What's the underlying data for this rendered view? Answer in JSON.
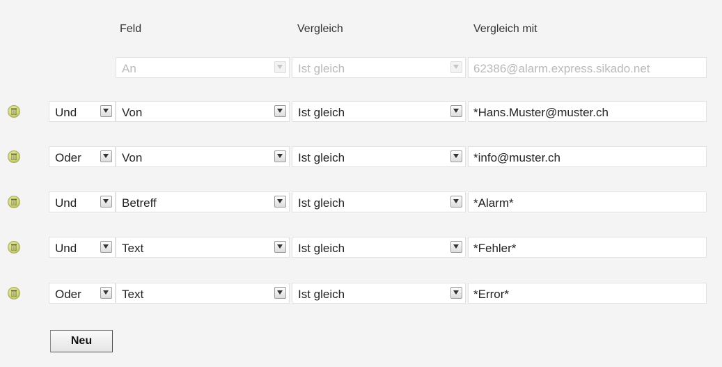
{
  "headers": {
    "feld": "Feld",
    "vergleich": "Vergleich",
    "vergleich_mit": "Vergleich mit"
  },
  "first_row": {
    "feld": "An",
    "vergleich": "Ist gleich",
    "value": "62386@alarm.express.sikado.net"
  },
  "rows": [
    {
      "logic": "Und",
      "feld": "Von",
      "vergleich": "Ist gleich",
      "value": "*Hans.Muster@muster.ch"
    },
    {
      "logic": "Oder",
      "feld": "Von",
      "vergleich": "Ist gleich",
      "value": "*info@muster.ch"
    },
    {
      "logic": "Und",
      "feld": "Betreff",
      "vergleich": "Ist gleich",
      "value": "*Alarm*"
    },
    {
      "logic": "Und",
      "feld": "Text",
      "vergleich": "Ist gleich",
      "value": "*Fehler*"
    },
    {
      "logic": "Oder",
      "feld": "Text",
      "vergleich": "Ist gleich",
      "value": "*Error*"
    }
  ],
  "buttons": {
    "new_label": "Neu"
  },
  "icons": {
    "delete": "trash-icon",
    "dropdown": "chevron-down-icon"
  }
}
